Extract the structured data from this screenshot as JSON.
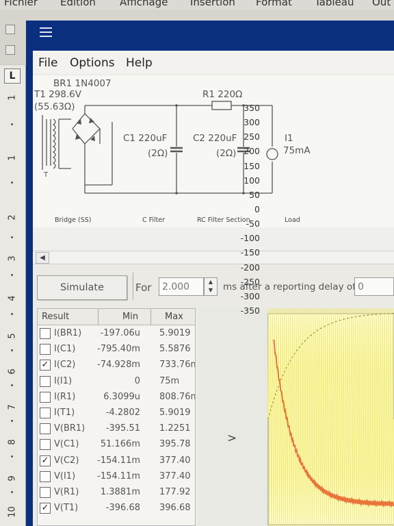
{
  "background_app": {
    "menu": [
      "Fichier",
      "Edition",
      "Affichage",
      "Insertion",
      "Format",
      "Tableau",
      "Out"
    ],
    "ruler_corner": "L",
    "ruler_numbers": [
      "1",
      "1",
      "2",
      "3",
      "4",
      "5",
      "6",
      "7",
      "8",
      "9",
      "10"
    ]
  },
  "menu": {
    "file": "File",
    "options": "Options",
    "help": "Help"
  },
  "schematic": {
    "rectifier_label": "BR1 1N4007",
    "transformer_label": "T1 298.6V",
    "transformer_value": "(55.63Ω)",
    "transformer_ref": "T",
    "c1_label": "C1 220uF",
    "c1_value": "(2Ω)",
    "r1_label": "R1 220Ω",
    "c2_label": "C2 220uF",
    "c2_value": "(2Ω)",
    "load_label": "I1",
    "load_value": "75mA",
    "section_bridge": "Bridge (SS)",
    "section_cfilter": "C Filter",
    "section_rc": "RC Filter Section",
    "section_load": "Load"
  },
  "scroll": {
    "left_arrow": "◀"
  },
  "simulate": {
    "button_label": "Simulate",
    "for_label": "For",
    "duration_value": "2.000",
    "units_label": "ms  after a reporting delay of",
    "delay_value": "0",
    "spin_up": "▲",
    "spin_down": "▼"
  },
  "results": {
    "headers": {
      "result": "Result",
      "min": "Min",
      "max": "Max"
    },
    "rows": [
      {
        "name": "I(BR1)",
        "min": "-197.06u",
        "max": "5.9019",
        "checked": false,
        "mark": ""
      },
      {
        "name": "I(C1)",
        "min": "-795.40m",
        "max": "5.5876",
        "checked": false,
        "mark": ""
      },
      {
        "name": "I(C2)",
        "min": "-74.928m",
        "max": "733.76m",
        "checked": true,
        "mark": "✓"
      },
      {
        "name": "I(I1)",
        "min": "0",
        "max": "75m",
        "checked": false,
        "mark": ""
      },
      {
        "name": "I(R1)",
        "min": "6.3099u",
        "max": "808.76m",
        "checked": false,
        "mark": ""
      },
      {
        "name": "I(T1)",
        "min": "-4.2802",
        "max": "5.9019",
        "checked": false,
        "mark": ""
      },
      {
        "name": "V(BR1)",
        "min": "-395.51",
        "max": "1.2251",
        "checked": false,
        "mark": ""
      },
      {
        "name": "V(C1)",
        "min": "51.166m",
        "max": "395.78",
        "checked": false,
        "mark": ""
      },
      {
        "name": "V(C2)",
        "min": "-154.11m",
        "max": "377.40",
        "checked": true,
        "mark": "✓"
      },
      {
        "name": "V(I1)",
        "min": "-154.11m",
        "max": "377.40",
        "checked": false,
        "mark": ""
      },
      {
        "name": "V(R1)",
        "min": "1.3881m",
        "max": "177.92",
        "checked": false,
        "mark": ""
      },
      {
        "name": "V(T1)",
        "min": "-396.68",
        "max": "396.68",
        "checked": true,
        "mark": "✓"
      }
    ]
  },
  "plot": {
    "axis_label": ">",
    "yticks": [
      "350",
      "300",
      "250",
      "200",
      "150",
      "100",
      "50",
      "0",
      "-50",
      "-100",
      "-150",
      "-200",
      "-250",
      "-300",
      "-350"
    ],
    "colors": {
      "vt1": "#f3ec6a",
      "vc2": "#9a9a3a",
      "ic2": "#e8743a",
      "background": "#ffffff"
    }
  },
  "chart_data": {
    "type": "line",
    "ylim": [
      -350,
      350
    ],
    "series": [
      {
        "name": "V(T1)",
        "description_values": "oscillating ±396.68",
        "min": -396.68,
        "max": 396.68
      },
      {
        "name": "V(C2)",
        "min": -0.15411,
        "max": 377.4
      },
      {
        "name": "I(C2)",
        "min": -0.074928,
        "max": 0.73376
      }
    ]
  }
}
